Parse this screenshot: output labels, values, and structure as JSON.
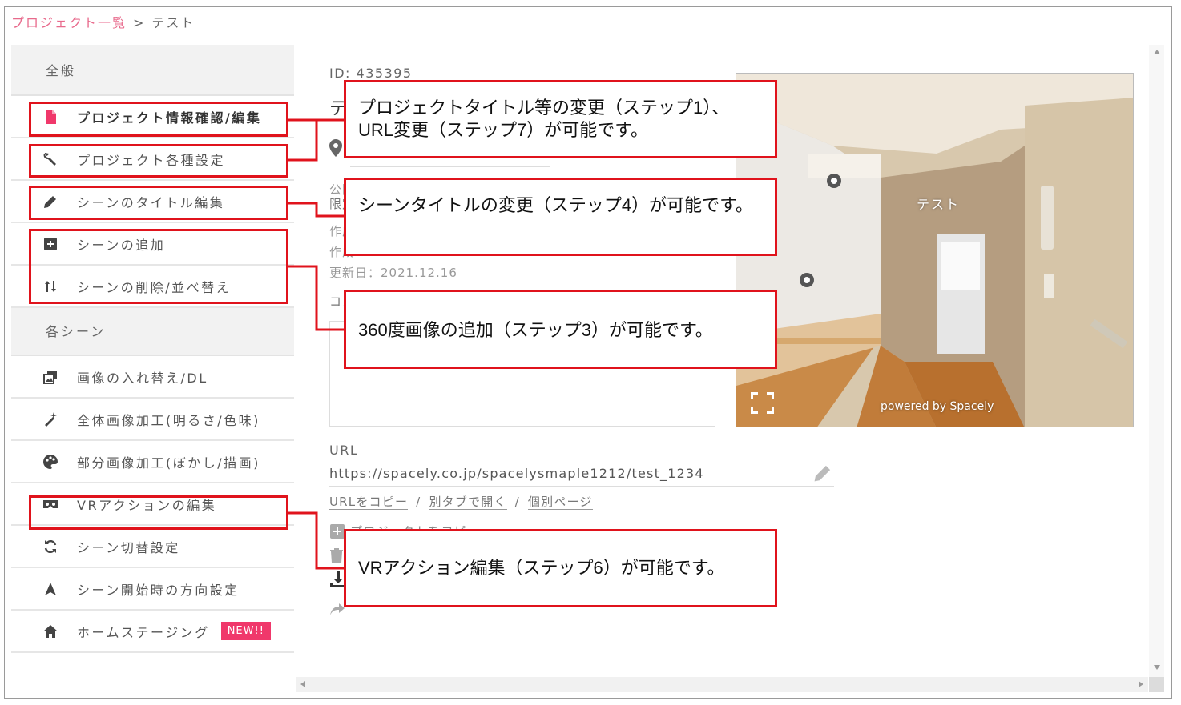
{
  "breadcrumb": {
    "project_list": "プロジェクト一覧",
    "separator": ">",
    "current": "テスト"
  },
  "sidebar": {
    "general_header": "全般",
    "general_items": [
      {
        "label": "プロジェクト情報確認/編集",
        "icon": "document-icon",
        "active": true
      },
      {
        "label": "プロジェクト各種設定",
        "icon": "wrench-icon"
      },
      {
        "label": "シーンのタイトル編集",
        "icon": "pencil-icon"
      },
      {
        "label": "シーンの追加",
        "icon": "plus-square-icon"
      },
      {
        "label": "シーンの削除/並べ替え",
        "icon": "sort-arrows-icon"
      }
    ],
    "scenes_header": "各シーン",
    "scene_items": [
      {
        "label": "画像の入れ替え/DL",
        "icon": "image-swap-icon"
      },
      {
        "label": "全体画像加工(明るさ/色味)",
        "icon": "magic-wand-icon"
      },
      {
        "label": "部分画像加工(ぼかし/描画)",
        "icon": "palette-icon"
      },
      {
        "label": "VRアクションの編集",
        "icon": "vr-goggles-icon"
      },
      {
        "label": "シーン切替設定",
        "icon": "refresh-icon"
      },
      {
        "label": "シーン開始時の方向設定",
        "icon": "direction-arrow-icon"
      },
      {
        "label": "ホームステージング",
        "icon": "home-icon",
        "badge": "NEW!!"
      }
    ]
  },
  "main": {
    "id_text": "ID: 435395",
    "title_fragment": "テ",
    "public_label_fragment": "公開状況",
    "public_value_fragment": "限定",
    "created_label_fragment_1": "作成",
    "created_label_fragment_2": "作成",
    "updated": "更新日：2021.12.16",
    "comment_label_fragment": "コメント",
    "url_label": "URL",
    "url_prefix": "https://spacely.co.jp/spacelysmaple1212/",
    "url_slug": "test_1234",
    "links": {
      "copy_url": "URLをコピー",
      "open_new_tab": "別タブで開く",
      "individual_page": "個別ページ",
      "separator": "/"
    },
    "copy_project": "プロジェクトをコピー"
  },
  "preview": {
    "scene_title": "テスト",
    "powered_by": "powered by Spacely"
  },
  "callouts": {
    "project_info": "プロジェクトタイトル等の変更（ステップ1）、URL変更（ステップ7）が可能です。",
    "scene_title": "シーンタイトルの変更（ステップ4）が可能です。",
    "add_scene": "360度画像の追加（ステップ3）が可能です。",
    "vr_action": "VRアクション編集（ステップ6）が可能です。"
  },
  "colors": {
    "highlight": "#e0131c",
    "breadcrumb_link": "#e86a8c",
    "badge": "#f0386b"
  }
}
